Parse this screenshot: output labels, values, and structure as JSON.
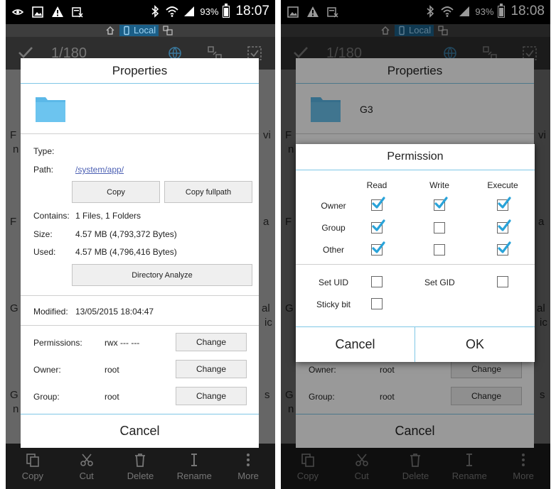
{
  "status": {
    "battery": "93%",
    "battery_level": 0.93,
    "time_left": "18:07",
    "time_right": "18:08"
  },
  "location": {
    "label": "Local"
  },
  "toolbar": {
    "count": "1/180"
  },
  "bottom_bar": [
    {
      "label": "Copy",
      "icon": "copy-icon"
    },
    {
      "label": "Cut",
      "icon": "scissors-icon"
    },
    {
      "label": "Delete",
      "icon": "trash-icon"
    },
    {
      "label": "Rename",
      "icon": "rename-icon"
    },
    {
      "label": "More",
      "icon": "more-icon"
    }
  ],
  "background_fragments": {
    "left": [
      "F",
      "vi",
      "n",
      "F",
      "a",
      "G",
      "al",
      "ic",
      "G",
      "s",
      "n"
    ],
    "right": [
      "F",
      "vi",
      "n",
      "F",
      "a",
      "G",
      "al",
      "ic",
      "G",
      "s",
      "n"
    ]
  },
  "properties": {
    "title": "Properties",
    "folder_name_right": "G3",
    "type_label": "Type:",
    "path_label": "Path:",
    "path_value": "/system/app/",
    "copy_button": "Copy",
    "copy_fullpath_button": "Copy fullpath",
    "contains_label": "Contains:",
    "contains_value": "1 Files, 1 Folders",
    "size_label": "Size:",
    "size_value": "4.57 MB (4,793,372 Bytes)",
    "used_label": "Used:",
    "used_value": "4.57 MB (4,796,416 Bytes)",
    "directory_analyze_button": "Directory Analyze",
    "modified_label": "Modified:",
    "modified_value": "13/05/2015 18:04:47",
    "permissions_label": "Permissions:",
    "permissions_value": "rwx --- ---",
    "owner_label": "Owner:",
    "owner_value": "root",
    "group_label": "Group:",
    "group_value": "root",
    "change_button": "Change",
    "cancel_button": "Cancel"
  },
  "permission": {
    "title": "Permission",
    "columns": [
      "Read",
      "Write",
      "Execute"
    ],
    "rows": [
      {
        "label": "Owner",
        "values": [
          true,
          true,
          true
        ]
      },
      {
        "label": "Group",
        "values": [
          true,
          false,
          true
        ]
      },
      {
        "label": "Other",
        "values": [
          true,
          false,
          true
        ]
      }
    ],
    "set_uid_label": "Set UID",
    "set_uid": false,
    "set_gid_label": "Set GID",
    "set_gid": false,
    "sticky_bit_label": "Sticky bit",
    "sticky_bit": false,
    "cancel_button": "Cancel",
    "ok_button": "OK"
  },
  "colors": {
    "accent": "#7fc7e6",
    "folder": "#5bb8e8",
    "check": "#29a3d9",
    "link": "#4b5fb3"
  }
}
